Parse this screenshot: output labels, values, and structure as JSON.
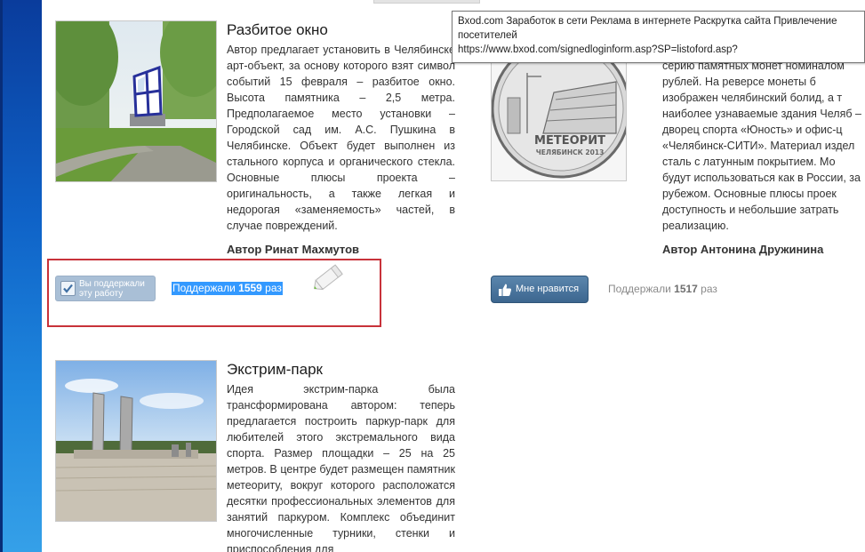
{
  "cards": [
    {
      "title": "Разбитое окно",
      "text": "Автор предлагает установить в Челябинске арт-объект, за основу которого взят символ событий 15 февраля – разбитое окно. Высота памятника – 2,5 метра. Предполагаемое место установки – Городской сад им. А.С. Пушкина в Челябинске. Объект будет выполнен из стального корпуса и органического стекла. Основные плюсы проекта – оригинальность, а также легкая и недорогая «заменяемость» частей, в случае повреждений.",
      "author": "Автор Ринат Махмутов",
      "supported_label": "Вы поддержали эту работу",
      "count_prefix": "Поддержали ",
      "count": "1559",
      "count_suffix": " раз"
    },
    {
      "title": "",
      "text": "серию памятных монет номиналом рублей. На реверсе монеты б изображен челябинский болид, а т наиболее узнаваемые здания Челяб – дворец спорта «Юность» и офис-ц «Челябинск-СИТИ». Материал издел сталь с латунным покрытием. Мо будут использоваться как в России, за рубежом. Основные плюсы проек доступность и небольшие затрать реализацию.",
      "author": "Автор Антонина Дружинина",
      "like_label": "Мне нравится",
      "count_prefix": "Поддержали ",
      "count": "1517",
      "count_suffix": " раз",
      "coin_text": "МЕТЕОРИТ",
      "coin_subtext": "ЧЕЛЯБИНСК 2013"
    },
    {
      "title": "Экстрим-парк",
      "text": "Идея экстрим-парка была трансформирована автором: теперь предлагается построить паркур-парк для любителей этого экстремального вида спорта. Размер площадки – 25 на 25 метров. В центре будет размещен памятник метеориту, вокруг которого расположатся десятки профессиональных элементов для занятий паркуром. Комплекс объединит многочисленные турники, стенки и приспособления для"
    }
  ],
  "tooltip": {
    "line1": "Bxod.com Заработок в сети Реклама в интернете Раскрутка сайта Привлечение посетителей",
    "line2": "https://www.bxod.com/signedloginform.asp?SP=listoford.asp?"
  },
  "colors": {
    "left_strip": "#0f63c8",
    "highlight": "#3399ff",
    "red_box": "#c8323a",
    "like_button": "#3c668f"
  },
  "icons": [
    "check-icon",
    "pencil-icon",
    "thumbs-up-icon"
  ]
}
